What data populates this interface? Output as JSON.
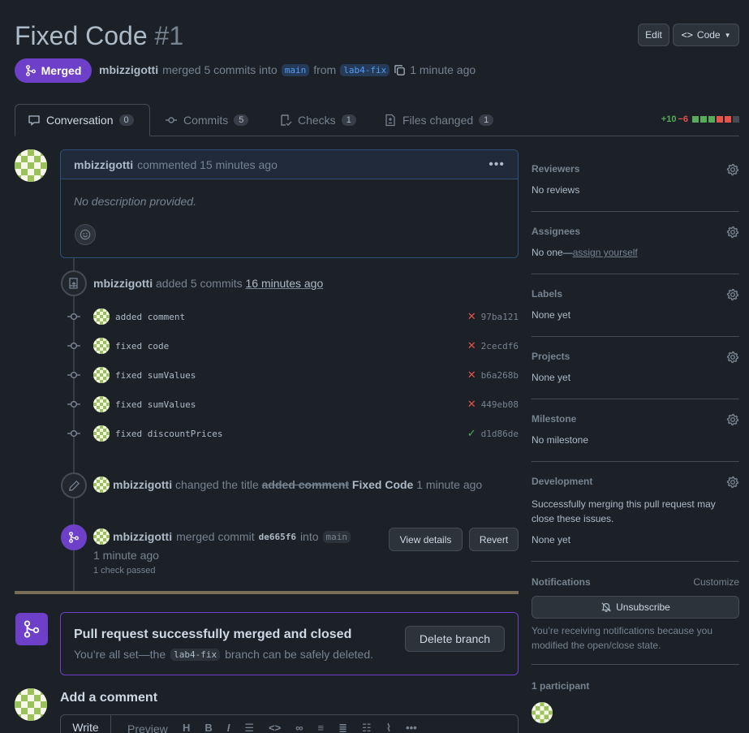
{
  "pr": {
    "title": "Fixed Code",
    "number": "#1",
    "state": "Merged",
    "author": "mbizzigotti",
    "summary_mid": "merged 5 commits into",
    "base_branch": "main",
    "from_word": "from",
    "head_branch": "lab4-fix",
    "time_ago": "1 minute ago"
  },
  "header_buttons": {
    "edit": "Edit",
    "code": "Code"
  },
  "tabs": [
    {
      "label": "Conversation",
      "count": "0",
      "icon": "comment-icon"
    },
    {
      "label": "Commits",
      "count": "5",
      "icon": "commit-icon"
    },
    {
      "label": "Checks",
      "count": "1",
      "icon": "checklist-icon"
    },
    {
      "label": "Files changed",
      "count": "1",
      "icon": "file-diff-icon"
    }
  ],
  "diffstat": {
    "additions": "+10",
    "deletions": "−6",
    "colors": [
      "#57ab5a",
      "#57ab5a",
      "#57ab5a",
      "#e5534b",
      "#e5534b",
      "#444c56"
    ]
  },
  "comment": {
    "author": "mbizzigotti",
    "action": "commented 15 minutes ago",
    "body": "No description provided."
  },
  "commits_event": {
    "author": "mbizzigotti",
    "action": "added 5 commits",
    "time": "16 minutes ago",
    "commits": [
      {
        "message": "added comment",
        "status": "fail",
        "sha": "97ba121"
      },
      {
        "message": "fixed code",
        "status": "fail",
        "sha": "2cecdf6"
      },
      {
        "message": "fixed sumValues",
        "status": "fail",
        "sha": "b6a268b"
      },
      {
        "message": "fixed sumValues",
        "status": "fail",
        "sha": "449eb08"
      },
      {
        "message": "fixed discountPrices",
        "status": "pass",
        "sha": "d1d86de"
      }
    ]
  },
  "rename_event": {
    "author": "mbizzigotti",
    "action": "changed the title",
    "old_title": "added comment",
    "new_title": "Fixed Code",
    "time": "1 minute ago"
  },
  "merge_event": {
    "author": "mbizzigotti",
    "action": "merged commit",
    "sha": "de665f6",
    "into": "into",
    "branch": "main",
    "time": "1 minute ago",
    "checks": "1 check passed",
    "view_details": "View details",
    "revert": "Revert"
  },
  "merge_box": {
    "title": "Pull request successfully merged and closed",
    "desc_pre": "You’re all set—the",
    "branch": "lab4-fix",
    "desc_post": "branch can be safely deleted.",
    "delete_button": "Delete branch"
  },
  "add_comment": {
    "heading": "Add a comment",
    "tab_write": "Write",
    "tab_preview": "Preview"
  },
  "sidebar": {
    "reviewers": {
      "label": "Reviewers",
      "value": "No reviews"
    },
    "assignees": {
      "label": "Assignees",
      "value": "No one—",
      "link": "assign yourself"
    },
    "labels": {
      "label": "Labels",
      "value": "None yet"
    },
    "projects": {
      "label": "Projects",
      "value": "None yet"
    },
    "milestone": {
      "label": "Milestone",
      "value": "No milestone"
    },
    "development": {
      "label": "Development",
      "desc": "Successfully merging this pull request may close these issues.",
      "value": "None yet"
    },
    "notifications": {
      "label": "Notifications",
      "customize": "Customize",
      "unsubscribe": "Unsubscribe",
      "note": "You’re receiving notifications because you modified the open/close state."
    },
    "participants": {
      "label": "1 participant"
    }
  },
  "colors": {
    "merged": "#6e40c9",
    "fail": "#e5534b",
    "pass": "#57ab5a",
    "background": "#1c2128"
  }
}
